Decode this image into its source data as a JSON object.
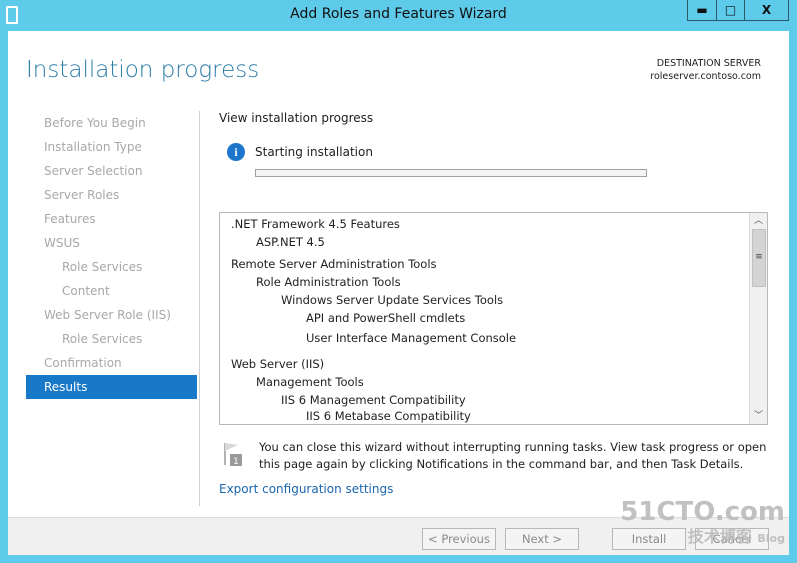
{
  "window": {
    "title": "Add Roles and Features Wizard",
    "minimize": "▬",
    "maximize": "□",
    "close": "X"
  },
  "header": {
    "title": "Installation progress",
    "dest_label": "DESTINATION SERVER",
    "dest_server": "roleserver.contoso.com"
  },
  "sidebar": {
    "items": [
      {
        "label": "Before You Begin"
      },
      {
        "label": "Installation Type"
      },
      {
        "label": "Server Selection"
      },
      {
        "label": "Server Roles"
      },
      {
        "label": "Features"
      },
      {
        "label": "WSUS"
      },
      {
        "label": "Role Services"
      },
      {
        "label": "Content"
      },
      {
        "label": "Web Server Role (IIS)"
      },
      {
        "label": "Role Services"
      },
      {
        "label": "Confirmation"
      },
      {
        "label": "Results"
      }
    ]
  },
  "main": {
    "view_label": "View installation progress",
    "status": "Starting installation",
    "progress_percent": 0,
    "items": [
      {
        "label": ".NET Framework 4.5 Features",
        "level": 0
      },
      {
        "label": "ASP.NET 4.5",
        "level": 1
      },
      {
        "label": "Remote Server Administration Tools",
        "level": 0
      },
      {
        "label": "Role Administration Tools",
        "level": 1
      },
      {
        "label": "Windows Server Update Services Tools",
        "level": 2
      },
      {
        "label": "API and PowerShell cmdlets",
        "level": 3
      },
      {
        "label": "User Interface Management Console",
        "level": 3
      },
      {
        "label": "Web Server (IIS)",
        "level": 0
      },
      {
        "label": "Management Tools",
        "level": 1
      },
      {
        "label": "IIS 6 Management Compatibility",
        "level": 2
      },
      {
        "label": "IIS 6 Metabase Compatibility",
        "level": 3
      }
    ],
    "note": "You can close this wizard without interrupting running tasks. View task progress or open this page again by clicking Notifications in the command bar, and then Task Details.",
    "note_badge": "1",
    "export_link": "Export configuration settings"
  },
  "footer": {
    "previous": "< Previous",
    "next": "Next >",
    "install": "Install",
    "cancel": "Cancel"
  },
  "watermark": {
    "line1": "51CTO.com",
    "line2": "技术博客",
    "line3": "Blog"
  }
}
